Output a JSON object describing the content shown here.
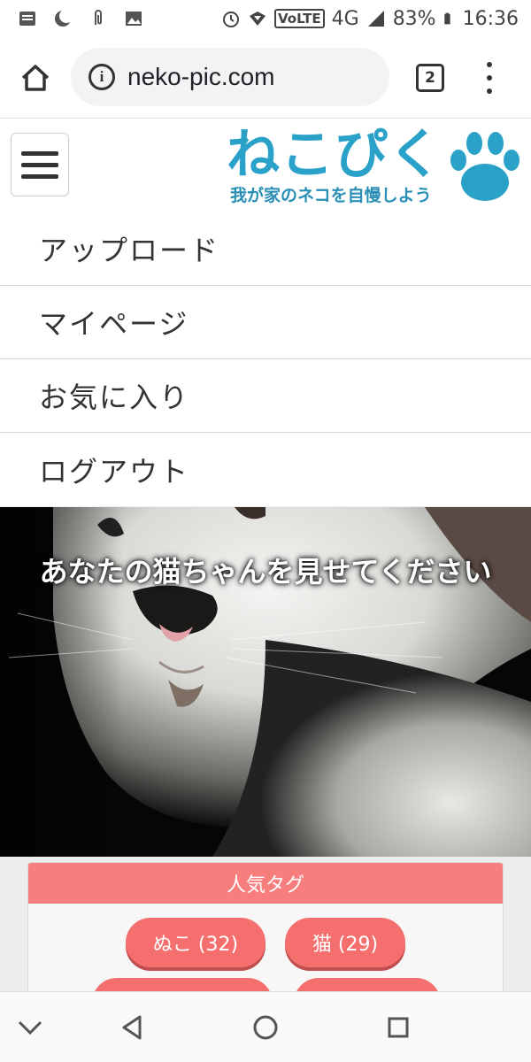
{
  "status_bar": {
    "network": "VoLTE",
    "network_type": "4G",
    "battery": "83%",
    "time": "16:36"
  },
  "browser": {
    "url": "neko-pic.com",
    "tab_count": "2"
  },
  "site": {
    "logo_title": "ねこぴく",
    "logo_subtitle": "我が家のネコを自慢しよう",
    "brand_color": "#2aa1c9"
  },
  "nav": {
    "items": [
      {
        "label": "アップロード"
      },
      {
        "label": "マイページ"
      },
      {
        "label": "お気に入り"
      },
      {
        "label": "ログアウト"
      }
    ]
  },
  "hero": {
    "headline": "あなたの猫ちゃんを見せてください"
  },
  "tags": {
    "header": "人気タグ",
    "items": [
      {
        "label": "ぬこ (32)"
      },
      {
        "label": "猫 (29)"
      }
    ],
    "accent_color": "#f87e7e"
  }
}
